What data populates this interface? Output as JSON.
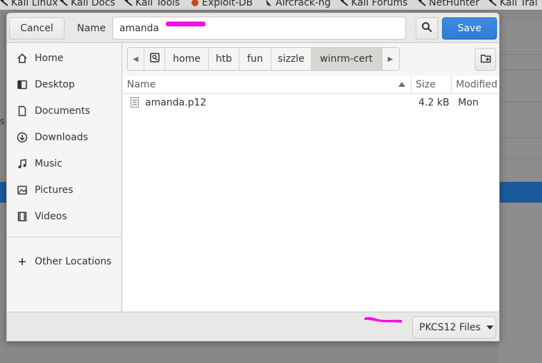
{
  "bookmarks": [
    "Kali Linux",
    "Kali Docs",
    "Kali Tools",
    "Exploit-DB",
    "Aircrack-ng",
    "Kali Forums",
    "NetHunter",
    "Kali Trai"
  ],
  "background": {
    "side_text": "s"
  },
  "dialog": {
    "cancel_label": "Cancel",
    "name_label": "Name",
    "name_value": "amanda",
    "save_label": "Save",
    "redaction_color": "#f40ee8",
    "accent_color": "#3584e4"
  },
  "sidebar": {
    "items": [
      {
        "label": "Home",
        "icon": "home-icon"
      },
      {
        "label": "Desktop",
        "icon": "desktop-icon"
      },
      {
        "label": "Documents",
        "icon": "documents-icon"
      },
      {
        "label": "Downloads",
        "icon": "downloads-icon"
      },
      {
        "label": "Music",
        "icon": "music-icon"
      },
      {
        "label": "Pictures",
        "icon": "pictures-icon"
      },
      {
        "label": "Videos",
        "icon": "videos-icon"
      }
    ],
    "other_locations": "Other Locations"
  },
  "pathbar": {
    "segments": [
      "home",
      "htb",
      "fun",
      "sizzle",
      "winrm-cert"
    ],
    "active": "winrm-cert"
  },
  "filelist": {
    "columns": {
      "name": "Name",
      "size": "Size",
      "modified": "Modified"
    },
    "rows": [
      {
        "name": "amanda.p12",
        "size": "4.2 kB",
        "modified": "Mon"
      }
    ]
  },
  "footer": {
    "filter_label": "PKCS12 Files"
  }
}
